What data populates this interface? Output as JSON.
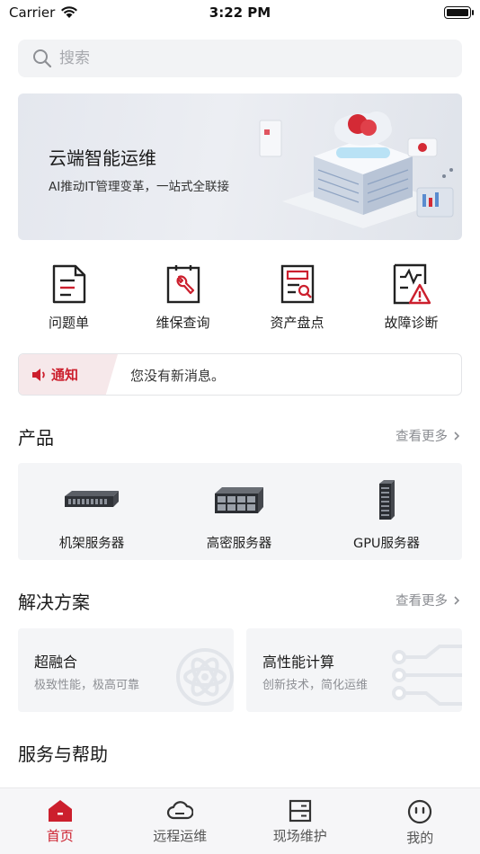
{
  "status_bar": {
    "carrier": "Carrier",
    "time": "3:22 PM"
  },
  "search": {
    "placeholder": "搜索"
  },
  "banner": {
    "title": "云端智能运维",
    "subtitle": "AI推动IT管理变革，一站式全联接"
  },
  "quick_actions": [
    {
      "label": "问题单",
      "icon": "document-list-icon"
    },
    {
      "label": "维保查询",
      "icon": "wrench-clipboard-icon"
    },
    {
      "label": "资产盘点",
      "icon": "asset-search-icon"
    },
    {
      "label": "故障诊断",
      "icon": "fault-warning-icon"
    }
  ],
  "notice": {
    "tag": "通知",
    "message": "您没有新消息。"
  },
  "products_section": {
    "title": "产品",
    "more": "查看更多",
    "items": [
      {
        "label": "机架服务器",
        "icon": "rack-server-icon"
      },
      {
        "label": "高密服务器",
        "icon": "high-density-server-icon"
      },
      {
        "label": "GPU服务器",
        "icon": "gpu-server-icon"
      }
    ]
  },
  "solutions_section": {
    "title": "解决方案",
    "more": "查看更多",
    "items": [
      {
        "title": "超融合",
        "subtitle": "极致性能，极高可靠",
        "icon": "atom-icon"
      },
      {
        "title": "高性能计算",
        "subtitle": "创新技术，简化运维",
        "icon": "circuit-icon"
      }
    ]
  },
  "services_section": {
    "title": "服务与帮助"
  },
  "tabbar": {
    "tabs": [
      {
        "label": "首页",
        "icon": "home-icon",
        "active": true
      },
      {
        "label": "远程运维",
        "icon": "cloud-icon",
        "active": false
      },
      {
        "label": "现场维护",
        "icon": "server-panel-icon",
        "active": false
      },
      {
        "label": "我的",
        "icon": "face-icon",
        "active": false
      }
    ]
  },
  "colors": {
    "brand_red": "#cc1f2d",
    "icon_dark": "#222222",
    "muted_text": "#8a8c91"
  }
}
